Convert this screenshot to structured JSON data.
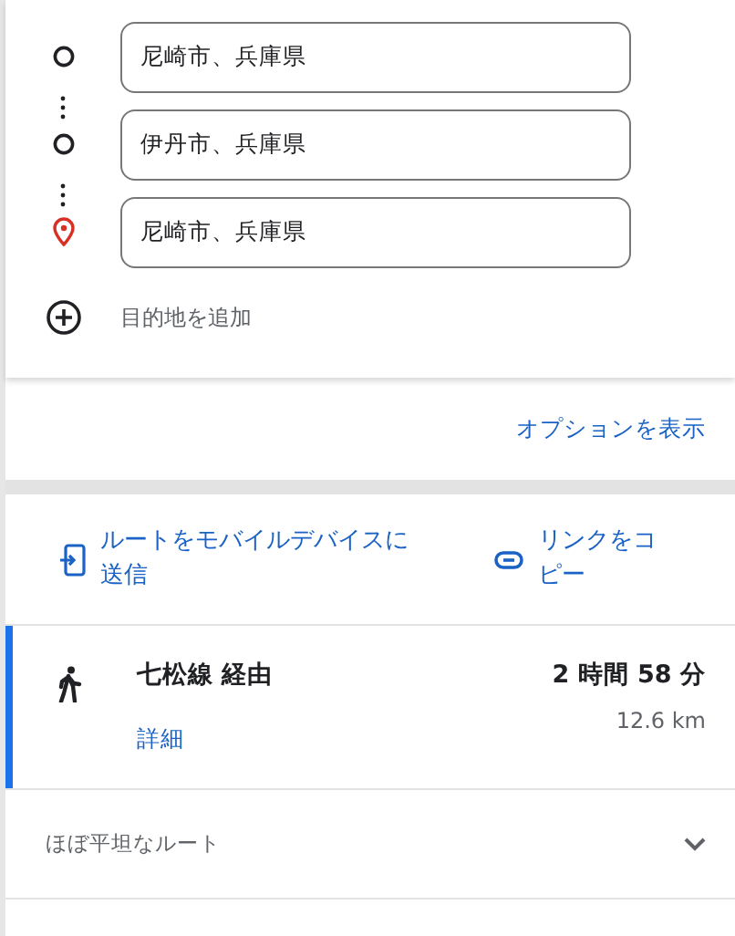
{
  "waypoints": [
    {
      "kind": "stop",
      "value": "尼崎市、兵庫県"
    },
    {
      "kind": "stop",
      "value": "伊丹市、兵庫県"
    },
    {
      "kind": "destination",
      "value": "尼崎市、兵庫県"
    }
  ],
  "add_destination": "目的地を追加",
  "options_link": "オプションを表示",
  "actions": [
    {
      "kind": "send",
      "label": "ルートをモバイルデバイスに送信"
    },
    {
      "kind": "link",
      "label": "リンクをコピー"
    }
  ],
  "route": {
    "selected": true,
    "title": "七松線 経由",
    "details_link": "詳細",
    "duration": "2 時間 58 分",
    "distance": "12.6 km"
  },
  "terrain": {
    "label": "ほぼ平坦なルート",
    "expanded": false
  }
}
